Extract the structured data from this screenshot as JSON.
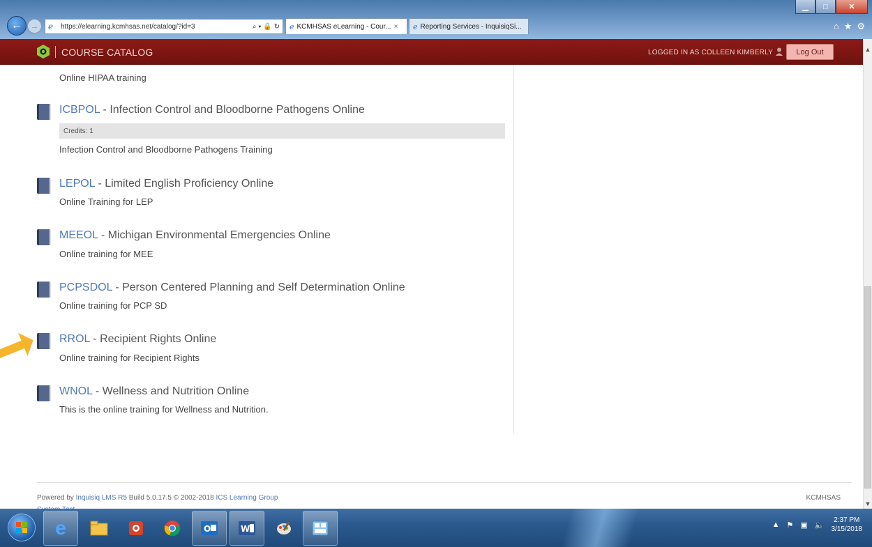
{
  "browser": {
    "url": "https://elearning.kcmhsas.net/catalog/?id=3",
    "tabs": [
      {
        "label": "KCMHSAS eLearning - Cour...",
        "active": true
      },
      {
        "label": "Reporting Services - InquisiqSi...",
        "active": false
      }
    ],
    "close_tab_glyph": "×",
    "address_tools": "⌕ ▾ 🔒 ↻"
  },
  "header": {
    "title": "COURSE CATALOG",
    "logged_in": "LOGGED IN AS COLLEEN KIMBERLY",
    "logout_label": "Log Out",
    "accent": "#7a1410"
  },
  "catalog": {
    "top_description": "Online HIPAA training",
    "courses": [
      {
        "code": "ICBPOL",
        "sep": " - ",
        "name": "Infection Control and Bloodborne Pathogens Online",
        "credits": "Credits: 1",
        "description": "Infection Control and Bloodborne Pathogens Training"
      },
      {
        "code": "LEPOL",
        "sep": " - ",
        "name": "Limited English Proficiency Online",
        "description": "Online Training for LEP"
      },
      {
        "code": "MEEOL",
        "sep": " - ",
        "name": "Michigan Environmental Emergencies Online",
        "description": "Online training for MEE"
      },
      {
        "code": "PCPSDOL",
        "sep": " - ",
        "name": "Person Centered Planning and Self Determination Online",
        "description": "Online training for PCP SD"
      },
      {
        "code": "RROL",
        "sep": " - ",
        "name": "Recipient Rights Online",
        "description": "Online training for Recipient Rights"
      },
      {
        "code": "WNOL",
        "sep": " - ",
        "name": "Wellness and Nutrition Online",
        "description": "This is the online training for Wellness and Nutrition."
      }
    ]
  },
  "footer": {
    "powered_prefix": "Powered by ",
    "product": "Inquisiq LMS R5",
    "build": " Build 5.0.17.5  © 2002-2018 ",
    "company": "ICS Learning Group",
    "system": "System Test",
    "org": "KCMHSAS"
  },
  "taskbar": {
    "time": "2:37 PM",
    "date": "3/15/2018"
  },
  "icons": [
    "ie-icon",
    "search-icon",
    "lock-icon",
    "refresh-icon",
    "home-icon",
    "star-icon",
    "gear-icon",
    "user-icon",
    "book-icon",
    "windows-start-icon"
  ]
}
